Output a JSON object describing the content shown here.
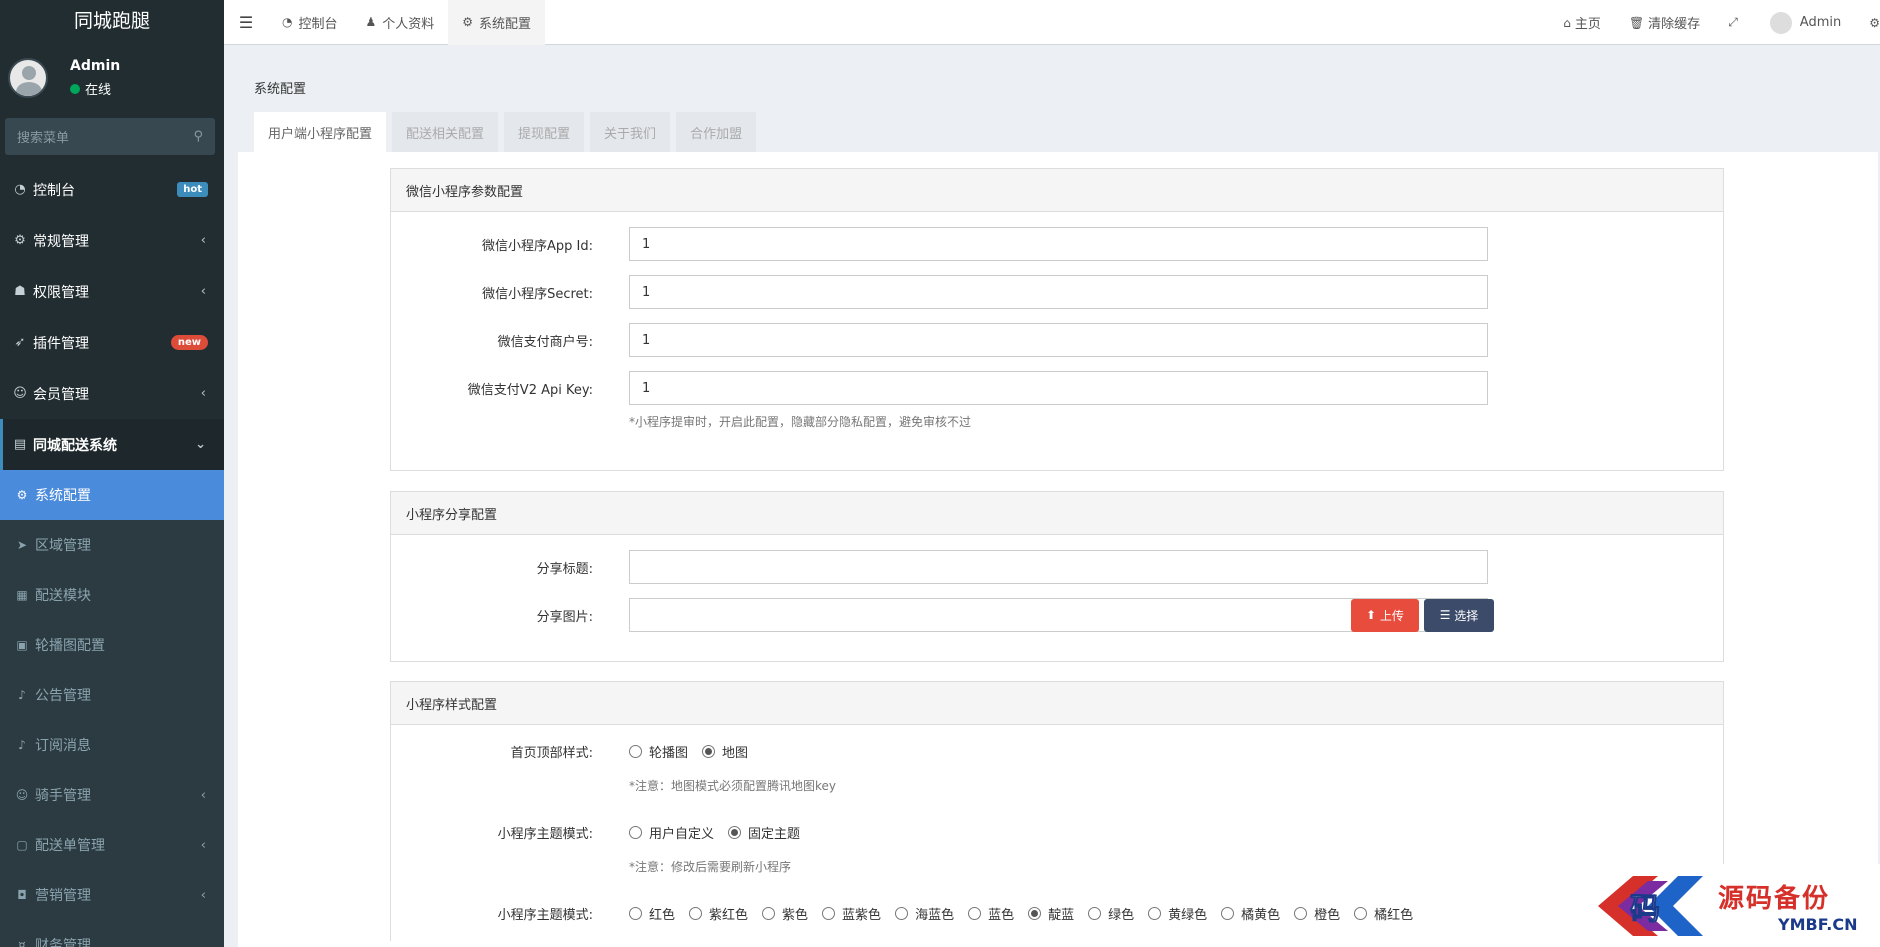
{
  "app": {
    "title": "同城跑腿"
  },
  "user": {
    "name": "Admin",
    "status": "在线"
  },
  "search": {
    "placeholder": "搜索菜单"
  },
  "menu": [
    {
      "label": "控制台",
      "badge": "hot"
    },
    {
      "label": "常规管理",
      "arrow": "‹"
    },
    {
      "label": "权限管理",
      "arrow": "‹"
    },
    {
      "label": "插件管理",
      "badge": "new"
    },
    {
      "label": "会员管理",
      "arrow": "‹"
    },
    {
      "label": "同城配送系统",
      "arrow": "⌄"
    }
  ],
  "submenu": [
    {
      "label": "系统配置"
    },
    {
      "label": "区域管理"
    },
    {
      "label": "配送模块"
    },
    {
      "label": "轮播图配置"
    },
    {
      "label": "公告管理"
    },
    {
      "label": "订阅消息"
    },
    {
      "label": "骑手管理",
      "arrow": "‹"
    },
    {
      "label": "配送单管理",
      "arrow": "‹"
    },
    {
      "label": "营销管理",
      "arrow": "‹"
    },
    {
      "label": "财务管理"
    }
  ],
  "header": {
    "tabs": [
      "控制台",
      "个人资料",
      "系统配置"
    ],
    "home": "主页",
    "clear_cache": "清除缓存",
    "admin": "Admin"
  },
  "page": {
    "title": "系统配置",
    "tabs": [
      "用户端小程序配置",
      "配送相关配置",
      "提现配置",
      "关于我们",
      "合作加盟"
    ]
  },
  "wechat_panel": {
    "title": "微信小程序参数配置",
    "fields": [
      {
        "label": "微信小程序App Id:",
        "value": "1"
      },
      {
        "label": "微信小程序Secret:",
        "value": "1"
      },
      {
        "label": "微信支付商户号:",
        "value": "1"
      },
      {
        "label": "微信支付V2 Api Key:",
        "value": "1"
      }
    ],
    "help": "*小程序提审时，开启此配置，隐藏部分隐私配置，避免审核不过"
  },
  "share_panel": {
    "title": "小程序分享配置",
    "share_title_label": "分享标题:",
    "share_title_value": "",
    "share_image_label": "分享图片:",
    "share_image_value": "",
    "upload": "上传",
    "choose": "选择"
  },
  "style_panel": {
    "title": "小程序样式配置",
    "home_top_label": "首页顶部样式:",
    "home_top_options": [
      "轮播图",
      "地图"
    ],
    "home_top_selected": "地图",
    "home_top_note": "*注意：地图模式必须配置腾讯地图key",
    "theme_mode_label": "小程序主题模式:",
    "theme_mode_options": [
      "用户自定义",
      "固定主题"
    ],
    "theme_mode_selected": "固定主题",
    "theme_mode_note": "*注意：修改后需要刷新小程序",
    "theme_color_label": "小程序主题模式:",
    "theme_colors": [
      "红色",
      "紫红色",
      "紫色",
      "蓝紫色",
      "海蓝色",
      "蓝色",
      "靛蓝",
      "绿色",
      "黄绿色",
      "橘黄色",
      "橙色",
      "橘红色"
    ],
    "theme_color_selected": "靛蓝"
  },
  "watermark": {
    "cn": "源码备份",
    "en": "YMBF.CN",
    "logo_char": "码"
  },
  "colors": {
    "sidebar_bg": "#222d32",
    "active_item": "#4b8bdc",
    "upload_btn": "#e74c3c",
    "choose_btn": "#3c4b6a",
    "hot_badge": "#3c8dbc",
    "new_badge": "#dd4b39"
  }
}
